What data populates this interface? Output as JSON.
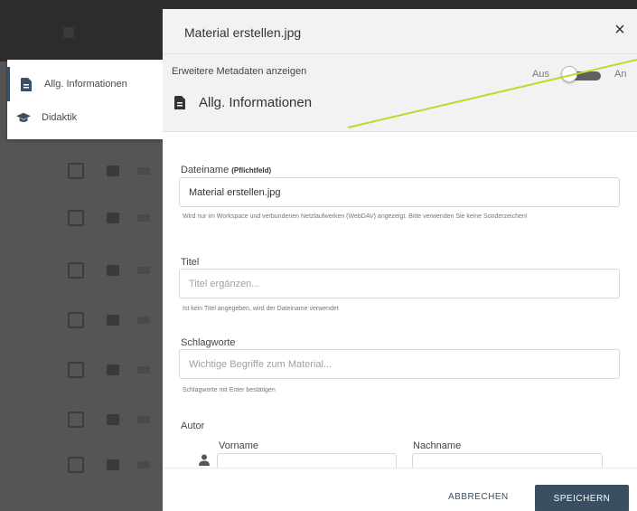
{
  "dialog": {
    "title": "Material erstellen.jpg",
    "close_label": "×"
  },
  "meta_toggle": {
    "label": "Erweitere Metadaten anzeigen",
    "off_label": "Aus",
    "on_label": "An",
    "state": "off"
  },
  "sidenav": {
    "items": [
      {
        "label": "Allg. Informationen",
        "icon": "document-icon",
        "active": true
      },
      {
        "label": "Didaktik",
        "icon": "graduation-cap-icon",
        "active": false
      }
    ]
  },
  "section": {
    "title": "Allg. Informationen",
    "icon": "document-icon"
  },
  "form": {
    "filename": {
      "label": "Dateiname",
      "required_label": "(Pflichtfeld)",
      "value": "Material erstellen.jpg",
      "hint": "Wird nur im Workspace und verbundenen Netzlaufwerken (WebDAV) angezeigt. Bitte verwenden Sie keine Sonderzeichen!"
    },
    "title": {
      "label": "Titel",
      "placeholder": "Titel ergänzen...",
      "hint": "Ist kein Titel angegeben, wird der Dateiname verwendet"
    },
    "keywords": {
      "label": "Schlagworte",
      "placeholder": "Wichtige Begriffe zum Material...",
      "hint": "Schlagworte mit Enter bestätigen"
    },
    "author": {
      "label": "Autor",
      "first_name_label": "Vorname",
      "last_name_label": "Nachname"
    }
  },
  "footer": {
    "cancel_label": "ABBRECHEN",
    "save_label": "SPEICHERN"
  },
  "colors": {
    "accent": "#3b4f63",
    "annotation_line": "#c6d62f",
    "header_bg": "#f2f2f2"
  }
}
